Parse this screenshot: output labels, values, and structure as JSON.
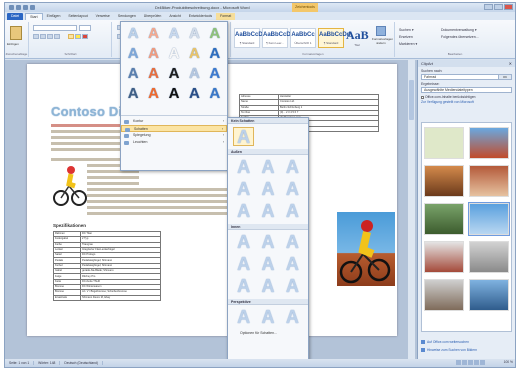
{
  "window": {
    "title": "Dr4Biker-Produktbeschreibung.docx - Microsoft Word",
    "context_tab": "Zeichentools"
  },
  "tabs": [
    "Datei",
    "Start",
    "Einfügen",
    "Seitenlayout",
    "Verweise",
    "Sendungen",
    "Überprüfen",
    "Ansicht",
    "Entwicklertools",
    "Format"
  ],
  "ribbon": {
    "groups": [
      "Zwischenablage",
      "Schriftart",
      "Absatz",
      "Formatvorlagen",
      "Bearbeiten"
    ],
    "paste_label": "Einfügen",
    "styles": [
      {
        "sample": "AaBbCcDd",
        "label": "¶ Standard"
      },
      {
        "sample": "AaBbCcDd",
        "label": "¶ Kein Leer..."
      },
      {
        "sample": "AaBbCc",
        "label": "Überschrift 1"
      },
      {
        "sample": "AaBbCcDd",
        "label": "¶ Standard"
      }
    ],
    "aab": {
      "sample": "AaB",
      "label": "Titel"
    },
    "change_styles_label": "Formatvorlagen ändern",
    "edit_items": [
      "Suchen ▾",
      "Ersetzen",
      "Markieren ▾"
    ],
    "extra_items": [
      "Dokumentverwaltung ▾",
      "Folgendes übersetzen..."
    ]
  },
  "document": {
    "title": "Contoso Di",
    "spec_heading": "Spezifikationen",
    "spec_rows": [
      [
        "Rahmen",
        "DC Titan"
      ],
      [
        "Federgabel",
        "2 Typ"
      ],
      [
        "Farbe",
        "Titangrau"
      ],
      [
        "Lenker",
        "Integrierter Flat-Lenkerbügel"
      ],
      [
        "Sattel",
        "DC Prologo"
      ],
      [
        "Pedale",
        "Pedalsteigbügel; Shimano"
      ],
      [
        "Kurbel",
        "Pedalsteigbügel; Shimano"
      ],
      [
        "Gabel",
        "gerade Ala-Blade; Shimano"
      ],
      [
        "Felge",
        "Ritchey Pro"
      ],
      [
        "Kette",
        "DC-Kette TSH0"
      ],
      [
        "Bremse",
        "DC Wintersaison"
      ],
      [
        "Bremse",
        "Art. V / Bügelbremse; Scheibenbremse"
      ],
      [
        "Ersatzteile",
        "Shimano Deore M, Ebay"
      ]
    ],
    "contact_rows": [
      [
        "Adresse",
        "Hersteller"
      ],
      [
        "Name",
        "Contoso Ltd."
      ],
      [
        "Straße",
        "Berlin-Schönberg 1"
      ],
      [
        "Tel./Fax",
        "(0)... 2 3 4 5 6 7"
      ],
      [
        "E-Mail",
        "nfo@contoso.com"
      ],
      [
        "Internet",
        "www.contoso.com"
      ],
      [
        "Produkt",
        "F. Willkürlich-Burgweg 17"
      ]
    ]
  },
  "wordart_gallery": {
    "rows": [
      [
        {
          "glyph": "A",
          "color": "#b9d0ea"
        },
        {
          "glyph": "A",
          "color": "#f4a98f"
        },
        {
          "glyph": "A",
          "color": "#c7d8ee"
        },
        {
          "glyph": "A",
          "color": "#d3ddea"
        },
        {
          "glyph": "A",
          "color": "#8fc27a"
        }
      ],
      [
        {
          "glyph": "A",
          "color": "#7ea7d8"
        },
        {
          "glyph": "A",
          "color": "#f19b7e"
        },
        {
          "glyph": "A",
          "color": "#f7f7f7"
        },
        {
          "glyph": "A",
          "color": "#e9c46a"
        },
        {
          "glyph": "A",
          "color": "#2f6fc0"
        }
      ],
      [
        {
          "glyph": "A",
          "color": "#5a7fae"
        },
        {
          "glyph": "A",
          "color": "#e86e3e"
        },
        {
          "glyph": "A",
          "color": "#1e1e1e"
        },
        {
          "glyph": "A",
          "color": "#b4c7e0"
        },
        {
          "glyph": "A",
          "color": "#3d7bd0"
        }
      ],
      [
        {
          "glyph": "A",
          "color": "#3f5f86"
        },
        {
          "glyph": "A",
          "color": "#f06a2e"
        },
        {
          "glyph": "A",
          "color": "#111111"
        },
        {
          "glyph": "A",
          "color": "#2a4f88"
        },
        {
          "glyph": "A",
          "color": "#3b79c9"
        }
      ]
    ],
    "menu": [
      {
        "label": "Kontur",
        "has_arrow": true
      },
      {
        "label": "Schatten",
        "has_arrow": true,
        "highlighted": true
      },
      {
        "label": "Spiegelung",
        "has_arrow": true
      },
      {
        "label": "Leuchten",
        "has_arrow": true
      }
    ]
  },
  "shadow_submenu": {
    "sections": [
      {
        "title": "Kein Schatten",
        "count": 1
      },
      {
        "title": "Außen",
        "count": 9
      },
      {
        "title": "Innen",
        "count": 9
      },
      {
        "title": "Perspektive",
        "count": 3
      }
    ],
    "more_label": "Optionen für Schatten..."
  },
  "clipart_pane": {
    "title": "ClipArt",
    "search_label": "Suchen nach:",
    "search_value": "Fahrrad",
    "go_label": "OK",
    "results_label": "Ergebnisse:",
    "results_value": "Ausgewählte Mediendateitypen",
    "check_label": "Office.com-Inhalte berücksichtigen",
    "link_label": "Zur Verfügung gestellt von Microsoft",
    "footer_links": [
      "Auf Office.com weitersuchen",
      "Hinweise zum Suchen von Bildern"
    ]
  },
  "statusbar": {
    "page": "Seite: 1 von 1",
    "words": "Wörter: 148",
    "language": "Deutsch (Deutschland)",
    "zoom": "100 %"
  }
}
